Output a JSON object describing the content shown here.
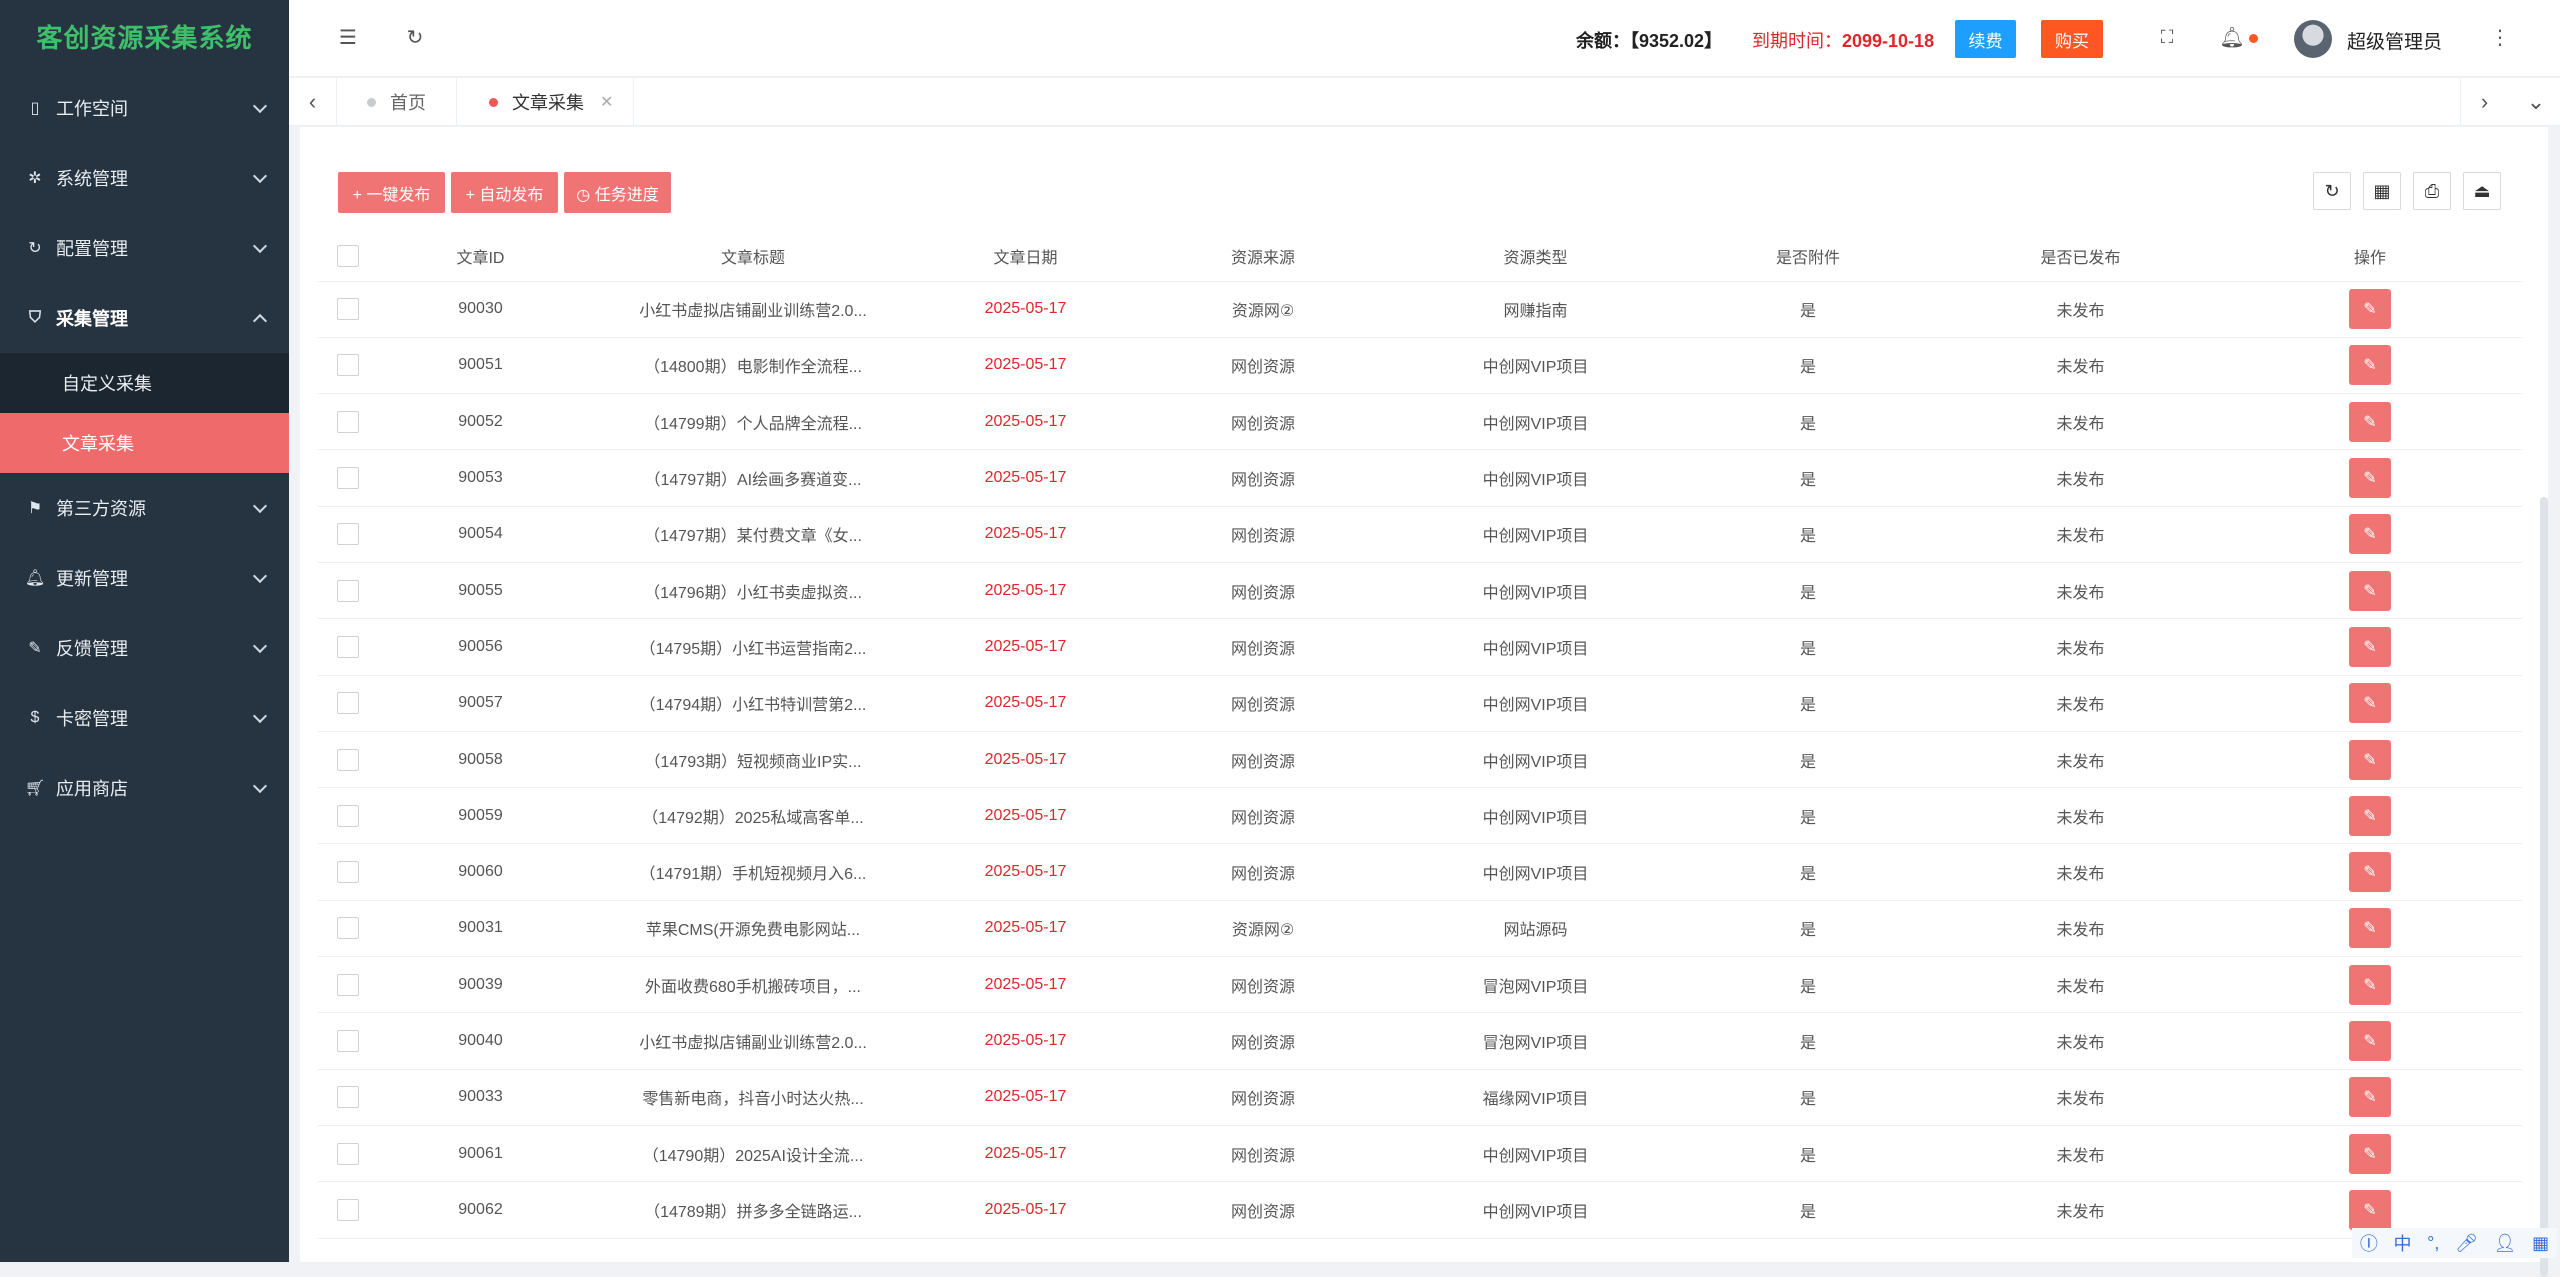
{
  "app": {
    "title": "客创资源采集系统"
  },
  "sidebar": {
    "items": [
      {
        "label": "工作空间",
        "icon": "tablet-icon"
      },
      {
        "label": "系统管理",
        "icon": "gear-icon"
      },
      {
        "label": "配置管理",
        "icon": "refresh-icon"
      },
      {
        "label": "采集管理",
        "icon": "shield-check-icon",
        "expanded": true,
        "children": [
          {
            "label": "自定义采集"
          },
          {
            "label": "文章采集",
            "active": true
          }
        ]
      },
      {
        "label": "第三方资源",
        "icon": "flag-icon"
      },
      {
        "label": "更新管理",
        "icon": "bell-icon"
      },
      {
        "label": "反馈管理",
        "icon": "edit-icon"
      },
      {
        "label": "卡密管理",
        "icon": "coin-icon"
      },
      {
        "label": "应用商店",
        "icon": "cart-icon"
      }
    ]
  },
  "header": {
    "balance_label": "余额：",
    "balance_value": "【9352.02】",
    "expire_label": "到期时间：",
    "expire_value": "2099-10-18",
    "renew_label": "续费",
    "buy_label": "购买",
    "username": "超级管理员"
  },
  "tabs": [
    {
      "label": "首页",
      "active": false
    },
    {
      "label": "文章采集",
      "active": true
    }
  ],
  "actions": {
    "publish_one": "+ 一键发布",
    "auto_publish": "+ 自动发布",
    "task_progress": "◷ 任务进度"
  },
  "table": {
    "columns": [
      "文章ID",
      "文章标题",
      "文章日期",
      "资源来源",
      "资源类型",
      "是否附件",
      "是否已发布",
      "操作"
    ],
    "rows": [
      [
        "90030",
        "小红书虚拟店铺副业训练营2.0...",
        "2025-05-17",
        "资源网②",
        "网赚指南",
        "是",
        "未发布"
      ],
      [
        "90051",
        "（14800期）电影制作全流程...",
        "2025-05-17",
        "网创资源",
        "中创网VIP项目",
        "是",
        "未发布"
      ],
      [
        "90052",
        "（14799期）个人品牌全流程...",
        "2025-05-17",
        "网创资源",
        "中创网VIP项目",
        "是",
        "未发布"
      ],
      [
        "90053",
        "（14797期）AI绘画多赛道变...",
        "2025-05-17",
        "网创资源",
        "中创网VIP项目",
        "是",
        "未发布"
      ],
      [
        "90054",
        "（14797期）某付费文章《女...",
        "2025-05-17",
        "网创资源",
        "中创网VIP项目",
        "是",
        "未发布"
      ],
      [
        "90055",
        "（14796期）小红书卖虚拟资...",
        "2025-05-17",
        "网创资源",
        "中创网VIP项目",
        "是",
        "未发布"
      ],
      [
        "90056",
        "（14795期）小红书运营指南2...",
        "2025-05-17",
        "网创资源",
        "中创网VIP项目",
        "是",
        "未发布"
      ],
      [
        "90057",
        "（14794期）小红书特训营第2...",
        "2025-05-17",
        "网创资源",
        "中创网VIP项目",
        "是",
        "未发布"
      ],
      [
        "90058",
        "（14793期）短视频商业IP实...",
        "2025-05-17",
        "网创资源",
        "中创网VIP项目",
        "是",
        "未发布"
      ],
      [
        "90059",
        "（14792期）2025私域高客单...",
        "2025-05-17",
        "网创资源",
        "中创网VIP项目",
        "是",
        "未发布"
      ],
      [
        "90060",
        "（14791期）手机短视频月入6...",
        "2025-05-17",
        "网创资源",
        "中创网VIP项目",
        "是",
        "未发布"
      ],
      [
        "90031",
        "苹果CMS(开源免费电影网站...",
        "2025-05-17",
        "资源网②",
        "网站源码",
        "是",
        "未发布"
      ],
      [
        "90039",
        "外面收费680手机搬砖项目，...",
        "2025-05-17",
        "网创资源",
        "冒泡网VIP项目",
        "是",
        "未发布"
      ],
      [
        "90040",
        "小红书虚拟店铺副业训练营2.0...",
        "2025-05-17",
        "网创资源",
        "冒泡网VIP项目",
        "是",
        "未发布"
      ],
      [
        "90033",
        "零售新电商，抖音小时达火热...",
        "2025-05-17",
        "网创资源",
        "福缘网VIP项目",
        "是",
        "未发布"
      ],
      [
        "90061",
        "（14790期）2025AI设计全流...",
        "2025-05-17",
        "网创资源",
        "中创网VIP项目",
        "是",
        "未发布"
      ],
      [
        "90062",
        "（14789期）拼多多全链路运...",
        "2025-05-17",
        "网创资源",
        "中创网VIP项目",
        "是",
        "未发布"
      ]
    ]
  },
  "ime": {
    "label": "中"
  }
}
